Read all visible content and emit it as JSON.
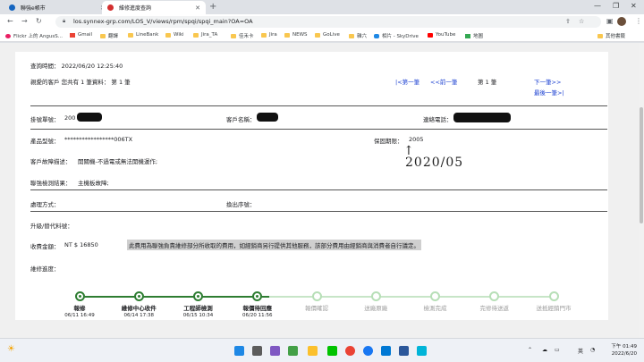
{
  "browser": {
    "tabs": [
      {
        "title": "聯強e帳市",
        "active": false
      },
      {
        "title": "維修進度查詢",
        "active": true
      }
    ],
    "url": "los.synnex-grp.com/LOS_V/views/rpm/spqi/spqi_main?OA=OA",
    "bookmarks": [
      "Flickr 上的 AngusS...",
      "Gmail",
      "翻譯",
      "LineBank",
      "Wiki",
      "Jira_TA",
      "佳禾卡",
      "Jira",
      "NEWS",
      "GoLive",
      "雜六",
      "相片 - SkyDrive",
      "YouTube",
      "地圖"
    ],
    "other_bookmarks": "其他書籤"
  },
  "header": {
    "query_time": "查詢時間： 2022/06/20 12:25:40",
    "customer_summary": "親愛的客戶 您共有 1 筆資料： 第 1 筆",
    "first": "|<第一筆",
    "prev": "<<前一筆",
    "current": "第 1 筆",
    "next": "下一筆>>",
    "last": "最後一筆>|"
  },
  "fields": {
    "ticket_label": "掛號單號：",
    "ticket_value": "200",
    "customer_label": "客戶名稱：",
    "phone_label": "連絡電話：",
    "model_label": "產品型號：",
    "model_value": "*****************006TX",
    "warranty_label": "保固期限：",
    "warranty_value": "2005",
    "fault_label": "客戶故障描述：",
    "fault_value": "開關機-不過電或無法開機運作;",
    "inspect_label": "聯強檢測結果：",
    "inspect_value": "主機板故障;",
    "handling_label": "處理方式：",
    "replaced_label": "換出序號：",
    "upgrade_label": "升級/替代料號：",
    "fee_label": "收費金額：",
    "fee_value": "NT $ 16850",
    "fee_note": "此費用為聯強負責維修部分所收取的費用，如經銷商另行提供其他服務，該部分費用由經銷商與消費者自行議定。",
    "progress_label": "維修進度："
  },
  "handwritten_note": "2020/05",
  "progress_steps": [
    {
      "label": "報修",
      "date": "06/11 16:49",
      "done": true
    },
    {
      "label": "維修中心收件",
      "date": "06/14 17:38",
      "done": true
    },
    {
      "label": "工程師檢測",
      "date": "06/15 10:34",
      "done": true
    },
    {
      "label": "報價待回應",
      "date": "06/20 11:56",
      "done": true
    },
    {
      "label": "報價確認",
      "date": "",
      "done": false
    },
    {
      "label": "送廠原廠",
      "date": "",
      "done": false
    },
    {
      "label": "檢測完成",
      "date": "",
      "done": false
    },
    {
      "label": "完修待送返",
      "date": "",
      "done": false
    },
    {
      "label": "送抵經銷門市",
      "date": "",
      "done": false
    }
  ],
  "taskbar": {
    "lang": "英",
    "time": "下午 01:49",
    "date": "2022/6/20"
  },
  "colors": {
    "done": "#2e7d32",
    "pending": "#b7dfb7",
    "link": "#1a3fd1",
    "redact": "#111111"
  }
}
